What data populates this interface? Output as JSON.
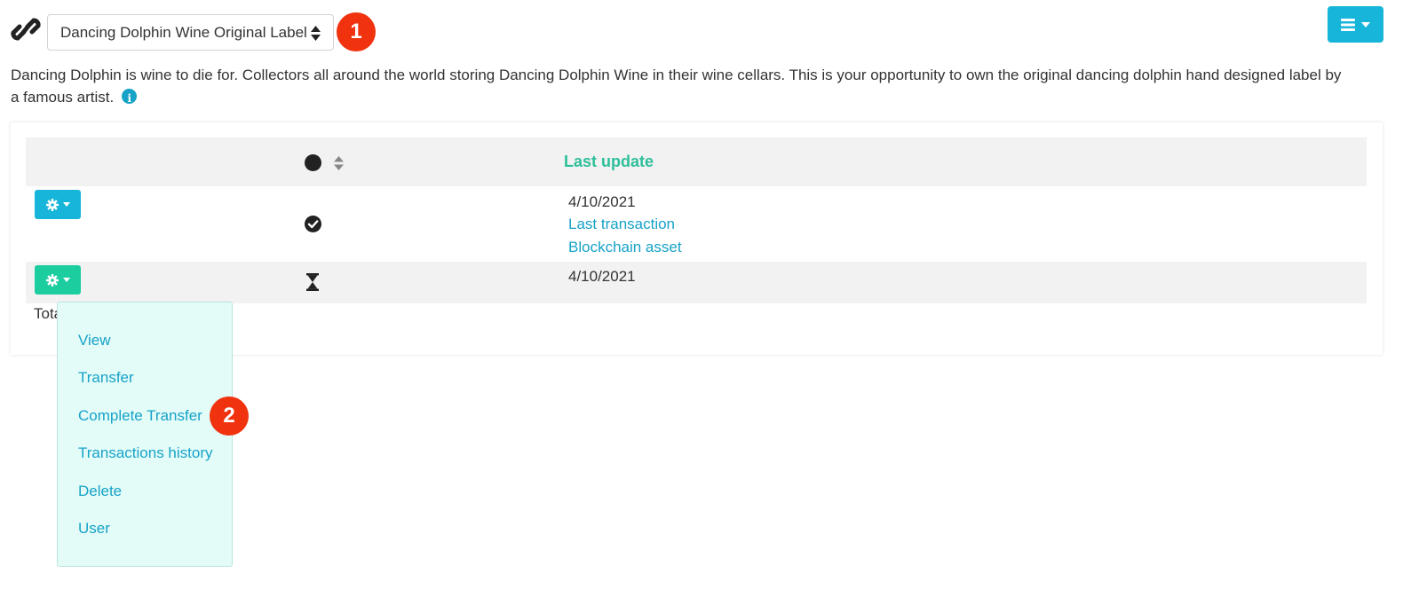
{
  "header": {
    "asset_select_value": "Dancing Dolphin Wine Original Label",
    "badge_1": "1",
    "badge_2": "2"
  },
  "description": {
    "text": "Dancing Dolphin is wine to die for. Collectors all around the world storing Dancing Dolphin Wine in their wine cellars. This is your opportunity to own the original dancing dolphin hand designed label by a famous artist."
  },
  "table": {
    "header_last_update": "Last update",
    "rows": [
      {
        "status_icon": "check-circle-icon",
        "date": "4/10/2021",
        "links": [
          "Last transaction",
          "Blockchain asset"
        ]
      },
      {
        "status_icon": "hourglass-icon",
        "date": "4/10/2021",
        "links": []
      }
    ],
    "total_label": "Tota"
  },
  "dropdown": {
    "items": [
      "View",
      "Transfer",
      "Complete Transfer",
      "Transactions history",
      "Delete",
      "User"
    ]
  },
  "colors": {
    "accent_blue": "#17b5d9",
    "accent_green": "#1ccd9f",
    "link": "#17a2c8",
    "header_text": "#2dbf9a",
    "badge": "#f0320f",
    "dropdown_bg": "#e3fcf8"
  }
}
